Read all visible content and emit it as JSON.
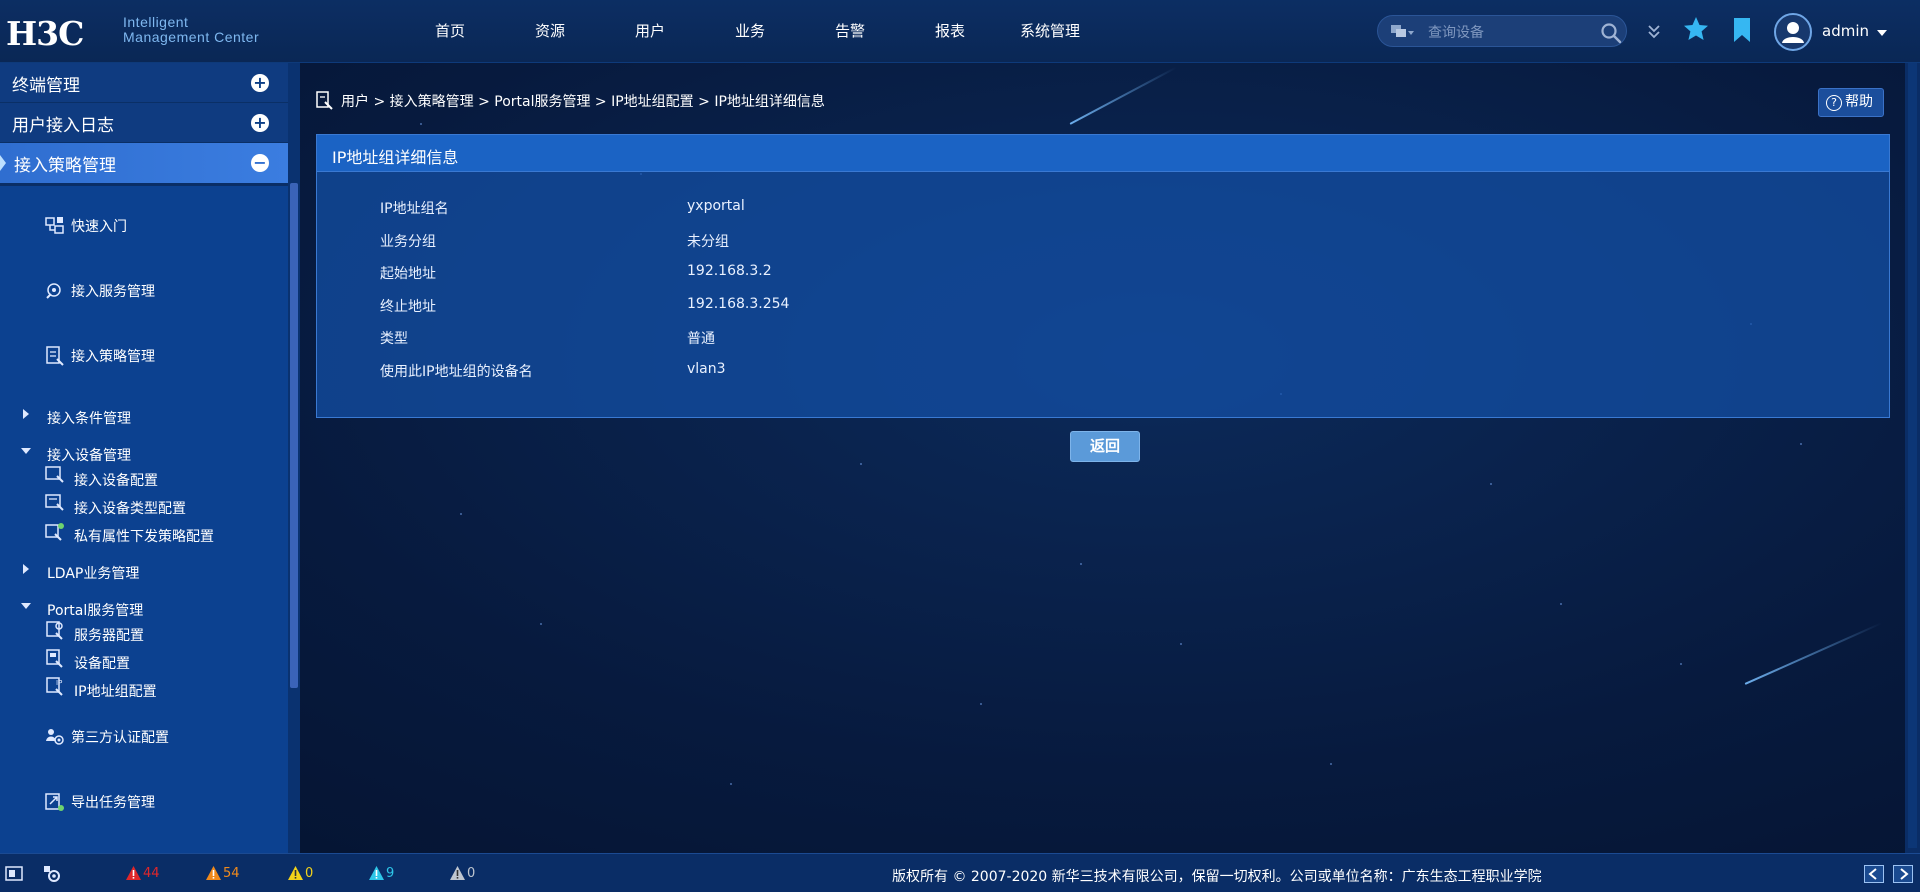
{
  "brand": {
    "logo": "H3C",
    "product_line1": "Intelligent",
    "product_line2": "Management Center"
  },
  "top_nav": [
    "首页",
    "资源",
    "用户",
    "业务",
    "告警",
    "报表",
    "系统管理"
  ],
  "search": {
    "placeholder": "查询设备",
    "value": ""
  },
  "user": {
    "name": "admin"
  },
  "sidebar": {
    "sections": [
      {
        "label": "终端管理",
        "toggle": "+"
      },
      {
        "label": "用户接入日志",
        "toggle": "+"
      },
      {
        "label": "接入策略管理",
        "toggle": "−"
      }
    ],
    "items": {
      "quick_start": "快速入门",
      "access_service": "接入服务管理",
      "access_policy": "接入策略管理",
      "access_condition": "接入条件管理",
      "access_device": "接入设备管理",
      "access_device_config": "接入设备配置",
      "access_device_type_config": "接入设备类型配置",
      "private_attr_policy": "私有属性下发策略配置",
      "ldap": "LDAP业务管理",
      "portal": "Portal服务管理",
      "server_config": "服务器配置",
      "device_config": "设备配置",
      "ip_group_config": "IP地址组配置",
      "third_party_auth": "第三方认证配置",
      "export_task": "导出任务管理"
    }
  },
  "breadcrumb": "用户 > 接入策略管理 > Portal服务管理 > IP地址组配置 > IP地址组详细信息",
  "help_label": "帮助",
  "panel": {
    "title": "IP地址组详细信息",
    "rows": [
      {
        "key": "IP地址组名",
        "value": "yxportal"
      },
      {
        "key": "业务分组",
        "value": "未分组"
      },
      {
        "key": "起始地址",
        "value": "192.168.3.2"
      },
      {
        "key": "终止地址",
        "value": "192.168.3.254"
      },
      {
        "key": "类型",
        "value": "普通"
      },
      {
        "key": "使用此IP地址组的设备名",
        "value": "vlan3"
      }
    ]
  },
  "back_label": "返回",
  "status": {
    "alarms": [
      {
        "level": "critical",
        "count": "44",
        "color": "#e0262a"
      },
      {
        "level": "major",
        "count": "54",
        "color": "#f08a1c"
      },
      {
        "level": "minor",
        "count": "0",
        "color": "#f2d21a"
      },
      {
        "level": "warning",
        "count": "9",
        "color": "#2ec6e8"
      },
      {
        "level": "unknown",
        "count": "0",
        "color": "#bfc6d0"
      }
    ],
    "copyright": "版权所有 © 2007-2020 新华三技术有限公司，保留一切权利。公司或单位名称：广东生态工程职业学院"
  },
  "colors": {
    "accent": "#3b7de0",
    "panel_head": "#1b63c4",
    "sidebar": "#0c4190"
  }
}
